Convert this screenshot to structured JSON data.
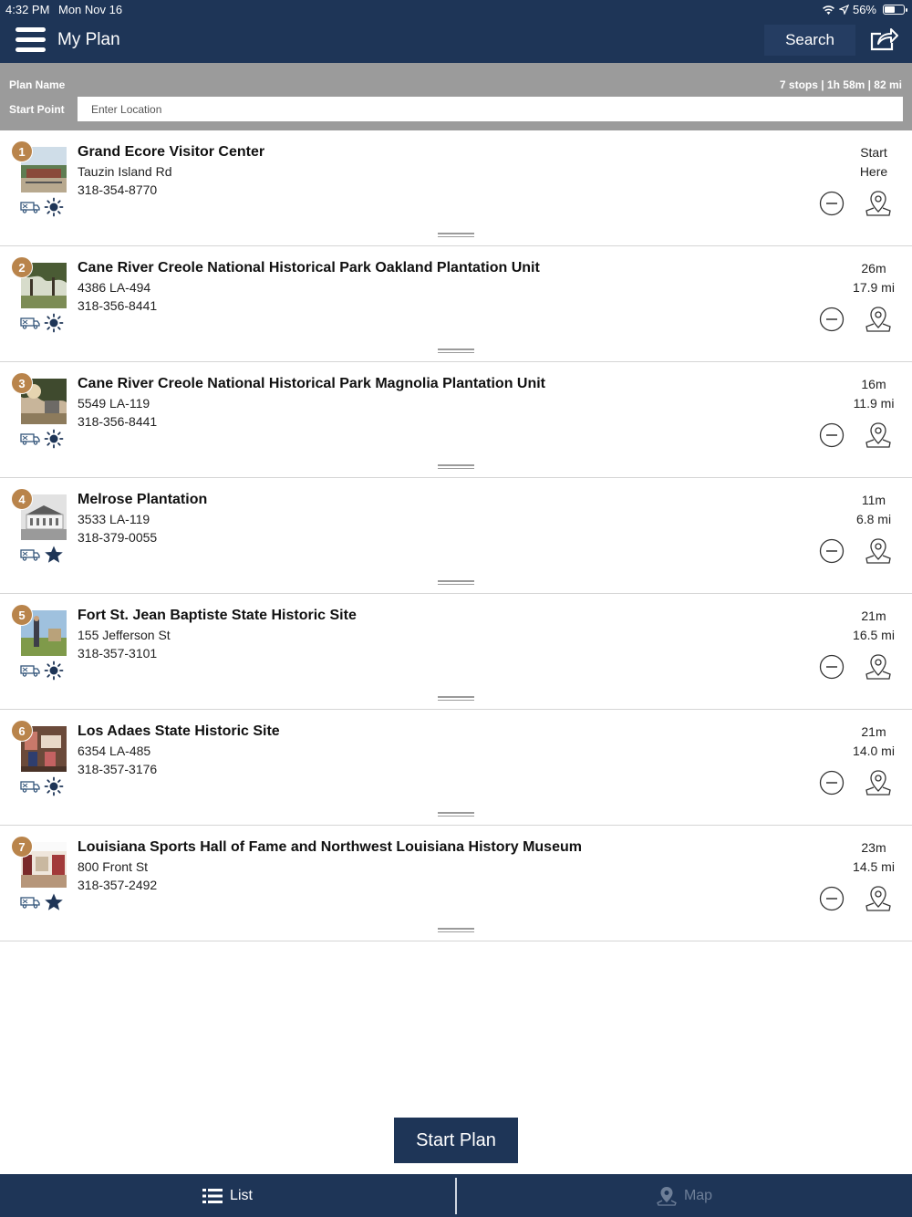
{
  "status": {
    "time": "4:32 PM",
    "date": "Mon Nov 16",
    "battery": "56%"
  },
  "nav": {
    "title": "My Plan",
    "search_label": "Search"
  },
  "plan": {
    "name_label": "Plan Name",
    "start_label": "Start Point",
    "summary": "7 stops | 1h 58m | 82 mi",
    "location_placeholder": "Enter Location",
    "location_value": ""
  },
  "stops": [
    {
      "number": "1",
      "name": "Grand Ecore Visitor Center",
      "address": "Tauzin Island Rd",
      "phone": "318-354-8770",
      "time": "Start",
      "distance": "Here",
      "amenity_icon": "sun-icon"
    },
    {
      "number": "2",
      "name": "Cane River Creole National Historical Park Oakland Plantation Unit",
      "address": "4386 LA-494",
      "phone": "318-356-8441",
      "time": "26m",
      "distance": "17.9 mi",
      "amenity_icon": "sun-icon"
    },
    {
      "number": "3",
      "name": "Cane River Creole National Historical Park Magnolia Plantation Unit",
      "address": "5549 LA-119",
      "phone": "318-356-8441",
      "time": "16m",
      "distance": "11.9 mi",
      "amenity_icon": "sun-icon"
    },
    {
      "number": "4",
      "name": "Melrose Plantation",
      "address": "3533 LA-119",
      "phone": "318-379-0055",
      "time": "11m",
      "distance": "6.8 mi",
      "amenity_icon": "star-icon"
    },
    {
      "number": "5",
      "name": "Fort St. Jean Baptiste State Historic Site",
      "address": "155 Jefferson St",
      "phone": "318-357-3101",
      "time": "21m",
      "distance": "16.5 mi",
      "amenity_icon": "sun-icon"
    },
    {
      "number": "6",
      "name": "Los Adaes State Historic Site",
      "address": "6354 LA-485",
      "phone": "318-357-3176",
      "time": "21m",
      "distance": "14.0 mi",
      "amenity_icon": "sun-icon"
    },
    {
      "number": "7",
      "name": "Louisiana Sports Hall of Fame and Northwest Louisiana History Museum",
      "address": "800 Front St",
      "phone": "318-357-2492",
      "time": "23m",
      "distance": "14.5 mi",
      "amenity_icon": "star-icon"
    }
  ],
  "start_button": "Start Plan",
  "tabs": {
    "list": "List",
    "map": "Map"
  },
  "colors": {
    "navy": "#1e3557",
    "badge": "#b9844b",
    "plan_bar": "#9b9b9b",
    "map_tab_inactive": "#6e7f98"
  }
}
